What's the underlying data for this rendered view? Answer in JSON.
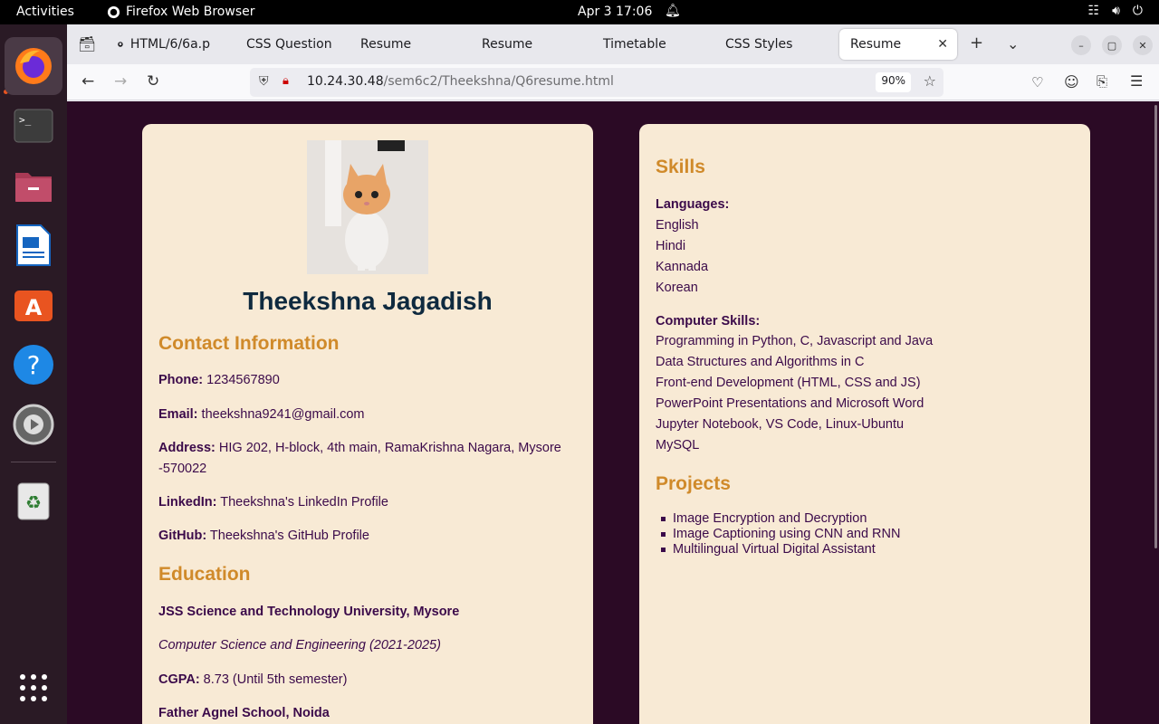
{
  "topbar": {
    "activities": "Activities",
    "app_name": "Firefox Web Browser",
    "datetime": "Apr 3  17:06"
  },
  "dock": {
    "items": [
      "firefox",
      "terminal",
      "files",
      "writer",
      "software",
      "help",
      "settings",
      "trash",
      "app-grid"
    ]
  },
  "tabs": [
    {
      "label": "HTML/6/6a.p",
      "icon": "github-icon"
    },
    {
      "label": "CSS Question",
      "icon": "green-icon"
    },
    {
      "label": "Resume"
    },
    {
      "label": "Resume"
    },
    {
      "label": "Timetable"
    },
    {
      "label": "CSS Styles"
    },
    {
      "label": "Resume"
    }
  ],
  "navbar": {
    "url_host": "10.24.30.48",
    "url_path": "/sem6c2/Theekshna/Q6resume.html",
    "zoom": "90%"
  },
  "resume": {
    "name": "Theekshna Jagadish",
    "contact_heading": "Contact Information",
    "phone_label": "Phone:",
    "phone": " 1234567890",
    "email_label": "Email:",
    "email": " theekshna9241@gmail.com",
    "address_label": "Address:",
    "address_line1": " HIG 202, H-block, 4th main, RamaKrishna Nagara, Mysore",
    "address_line2": "-570022",
    "linkedin_label": "LinkedIn:",
    "linkedin": " Theekshna's LinkedIn Profile",
    "github_label": "GitHub:",
    "github": " Theekshna's GitHub Profile",
    "education_heading": "Education",
    "university": "JSS Science and Technology University, Mysore",
    "degree": "Computer Science and Engineering (2021-2025)",
    "cgpa_label": "CGPA:",
    "cgpa": " 8.73 (Until 5th semester)",
    "school": "Father Agnel School, Noida",
    "skills_heading": "Skills",
    "languages_label": "Languages:",
    "languages": [
      "English",
      "Hindi",
      "Kannada",
      "Korean"
    ],
    "computer_skills_label": "Computer Skills:",
    "computer_skills": [
      "Programming in Python, C, Javascript and Java",
      "Data Structures and Algorithms in C",
      "Front-end Development (HTML, CSS and JS)",
      "PowerPoint Presentations and Microsoft Word",
      "Jupyter Notebook, VS Code, Linux-Ubuntu",
      "MySQL"
    ],
    "projects_heading": "Projects",
    "projects": [
      "Image Encryption and Decryption",
      "Image Captioning using CNN and RNN",
      "Multilingual Virtual Digital Assistant"
    ]
  }
}
